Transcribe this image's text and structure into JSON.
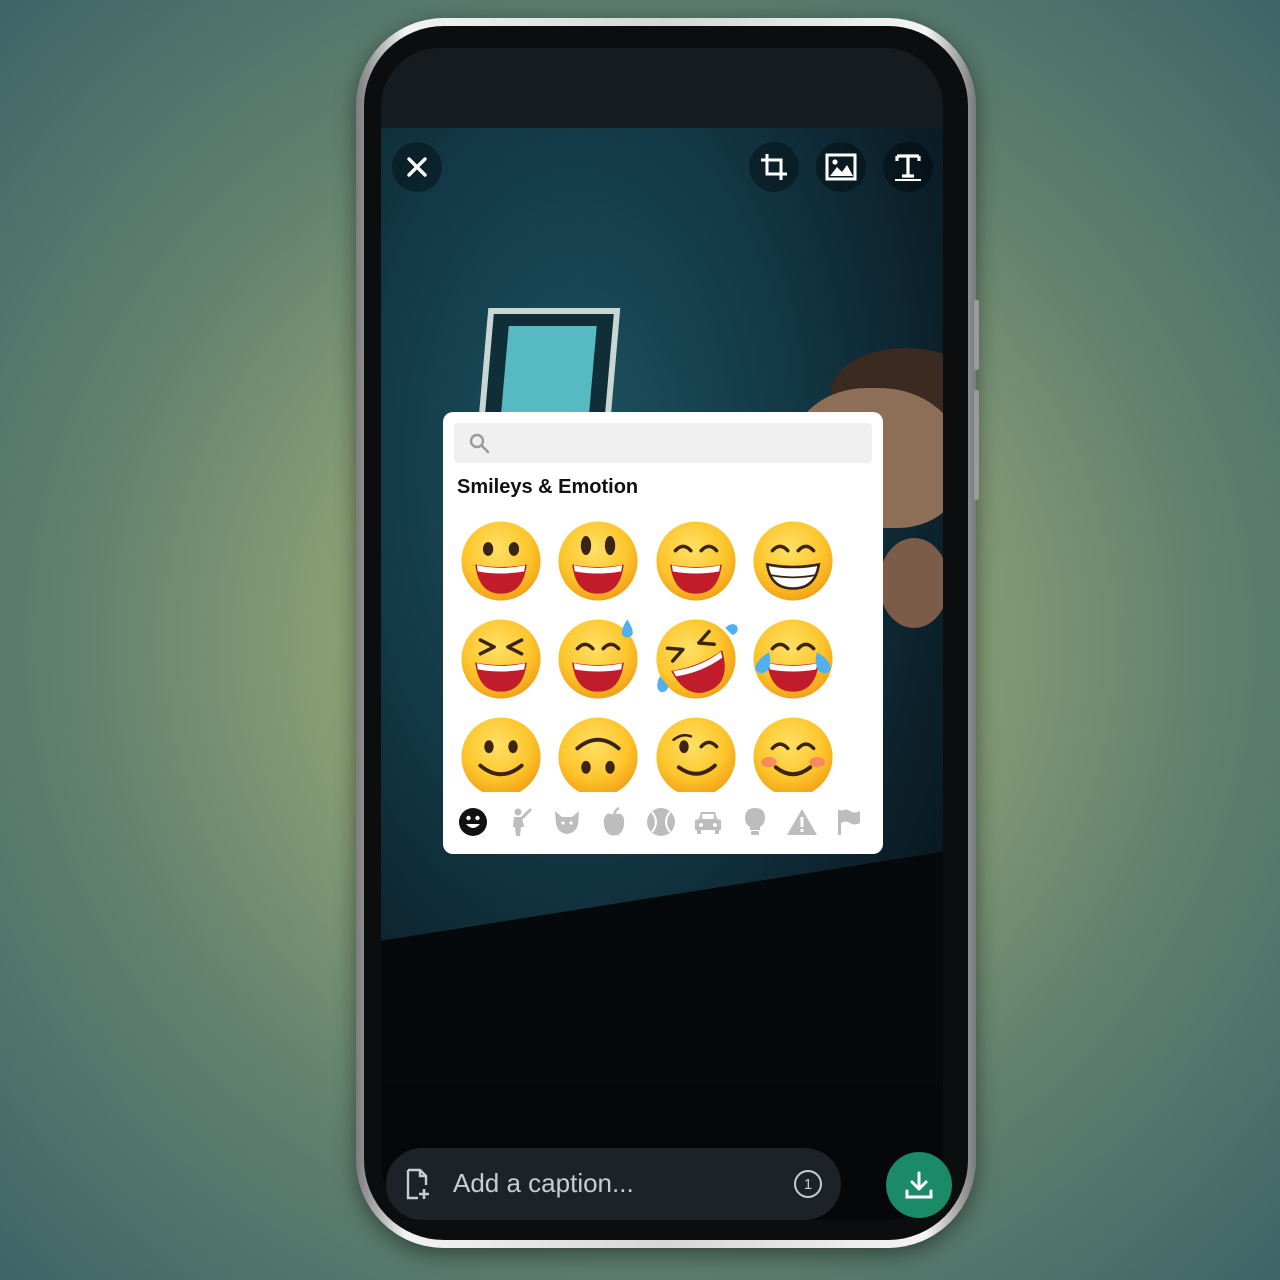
{
  "editor": {
    "caption": {
      "placeholder": "Add a caption...",
      "view_once": "1"
    },
    "toolbar": {
      "close_icon": "close-icon",
      "crop_icon": "crop-icon",
      "sticker_icon": "image-icon",
      "text_icon": "text-icon"
    },
    "send_icon": "download-icon",
    "accent_color": "#1b8a66"
  },
  "emoji_picker": {
    "search": {
      "value": "",
      "icon": "search-icon"
    },
    "section_title": "Smileys & Emotion",
    "emojis": [
      {
        "name": "grinning-face"
      },
      {
        "name": "grinning-face-big-eyes"
      },
      {
        "name": "grinning-face-smiling-eyes"
      },
      {
        "name": "beaming-face"
      },
      {
        "name": "grinning-squinting-face"
      },
      {
        "name": "grinning-face-sweat"
      },
      {
        "name": "rolling-on-floor-laughing"
      },
      {
        "name": "face-tears-of-joy"
      },
      {
        "name": "slightly-smiling-face"
      },
      {
        "name": "upside-down-face"
      },
      {
        "name": "winking-face"
      },
      {
        "name": "smiling-face-smiling-eyes"
      }
    ],
    "categories": [
      {
        "name": "smileys",
        "active": true
      },
      {
        "name": "people",
        "active": false
      },
      {
        "name": "animals",
        "active": false
      },
      {
        "name": "food",
        "active": false
      },
      {
        "name": "activity",
        "active": false
      },
      {
        "name": "travel",
        "active": false
      },
      {
        "name": "objects",
        "active": false
      },
      {
        "name": "symbols",
        "active": false
      },
      {
        "name": "flags",
        "active": false
      }
    ]
  }
}
